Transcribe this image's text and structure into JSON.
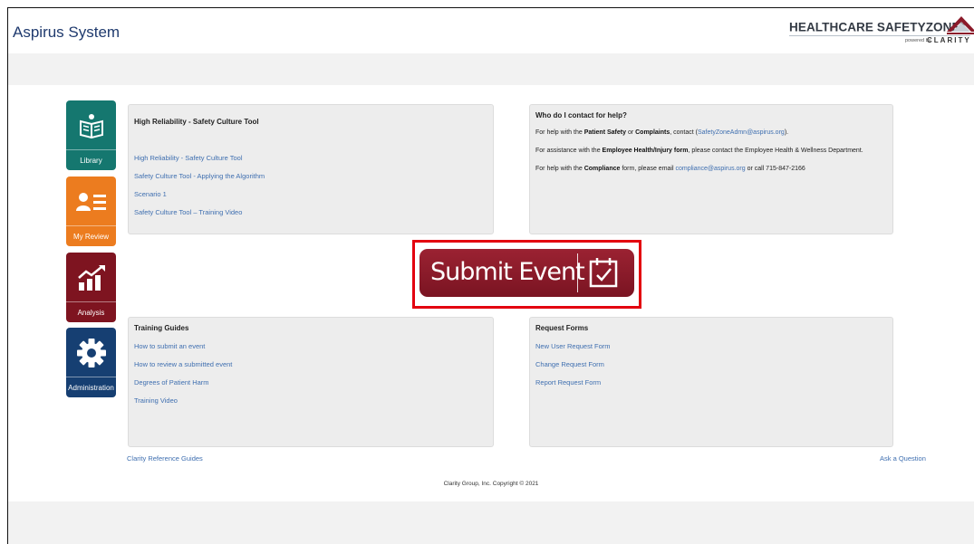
{
  "header": {
    "app_title": "Aspirus System",
    "brand_name": "HEALTHCARE SAFETYZONE",
    "brand_registered": "®",
    "brand_powered": "powered by",
    "brand_clarity": "CLARITY"
  },
  "sidebar": {
    "tiles": [
      {
        "label": "Library",
        "icon": "book-reader-icon",
        "color": "#15776f"
      },
      {
        "label": "My Review",
        "icon": "user-list-icon",
        "color": "#ec7c1f"
      },
      {
        "label": "Analysis",
        "icon": "trend-chart-icon",
        "color": "#7e1420"
      },
      {
        "label": "Administration",
        "icon": "gear-icon",
        "color": "#163f72"
      }
    ]
  },
  "panels": {
    "hr_tool": {
      "title": "High Reliability - Safety Culture Tool",
      "links": [
        "High Reliability - Safety Culture Tool",
        "Safety Culture Tool - Applying the Algorithm",
        "Scenario 1",
        "Safety Culture Tool – Training Video"
      ]
    },
    "help": {
      "title": "Who do I contact for help?",
      "line1_prefix": "For help with the ",
      "line1_bold1": "Patient Safety",
      "line1_or": " or ",
      "line1_bold2": "Complaints",
      "line1_mid": ", contact (",
      "line1_email": "SafetyZoneAdmn@aspirus.org",
      "line1_suffix": ").",
      "line2_prefix": "For assistance with the ",
      "line2_bold": "Employee Health/Injury form",
      "line2_suffix": ", please contact the Employee Health & Wellness Department.",
      "line3_prefix": "For help with the ",
      "line3_bold": "Compliance",
      "line3_mid": " form, please email ",
      "line3_email": "compliance@aspirus.org",
      "line3_suffix": " or call 715-847-2166"
    },
    "training_guides": {
      "title": "Training Guides",
      "links": [
        "How to submit an event",
        "How to review a submitted event",
        "Degrees of Patient Harm",
        "Training Video"
      ]
    },
    "request_forms": {
      "title": "Request Forms",
      "links": [
        "New User Request Form",
        "Change Request Form",
        "Report Request Form"
      ]
    }
  },
  "submit": {
    "label": "Submit Event",
    "icon": "calendar-check-icon",
    "color": "#8b1a2a",
    "highlight_color": "#e3000f"
  },
  "footer": {
    "left_link": "Clarity Reference Guides",
    "right_link": "Ask a Question",
    "copyright": "Clarity Group, Inc. Copyright © 2021"
  }
}
